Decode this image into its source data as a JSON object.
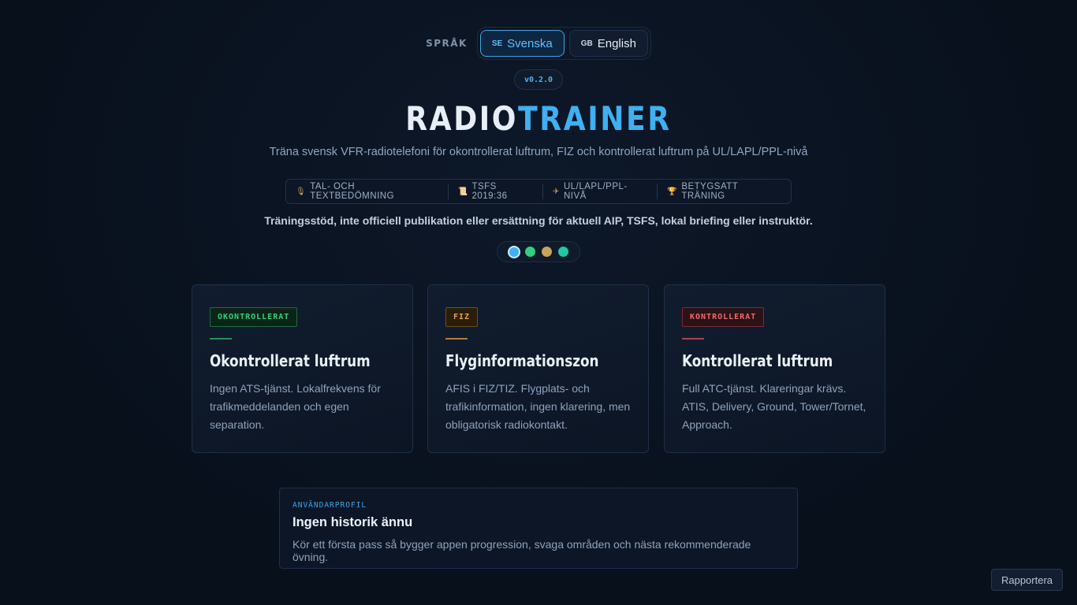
{
  "language": {
    "label": "SPRÅK",
    "options": [
      {
        "code": "SE",
        "label": "Svenska",
        "active": true
      },
      {
        "code": "GB",
        "label": "English",
        "active": false
      }
    ]
  },
  "version": "v0.2.0",
  "title": {
    "part1": "RADIO",
    "part2": "TRAINER"
  },
  "subtitle": "Träna svensk VFR-radiotelefoni för okontrollerat luftrum, FIZ och kontrollerat luftrum på UL/LAPL/PPL-nivå",
  "features": [
    {
      "icon": "microphone-icon",
      "glyph": "🎙",
      "label": "TAL- OCH TEXTBEDÖMNING"
    },
    {
      "icon": "scroll-icon",
      "glyph": "📜",
      "label": "TSFS 2019:36"
    },
    {
      "icon": "airplane-icon",
      "glyph": "✈",
      "label": "UL/LAPL/PPL-NIVÅ"
    },
    {
      "icon": "trophy-icon",
      "glyph": "🏆",
      "label": "BETYGSATT TRÄNING"
    }
  ],
  "disclaimer": "Träningsstöd, inte officiell publikation eller ersättning för aktuell AIP, TSFS, lokal briefing eller instruktör.",
  "theme_dots": [
    "#3fb0f2",
    "#2fd17e",
    "#c9a35a",
    "#22c7a4"
  ],
  "cards": [
    {
      "tag": "OKONTROLLERAT",
      "title": "Okontrollerat luftrum",
      "description": "Ingen ATS-tjänst. Lokalfrekvens för trafikmeddelanden och egen separation.",
      "color": "#35d07a"
    },
    {
      "tag": "FIZ",
      "title": "Flyginformationszon",
      "description": "AFIS i FIZ/TIZ. Flygplats- och trafikinformation, ingen klarering, men obligatorisk radiokontakt.",
      "color": "#e0a548"
    },
    {
      "tag": "KONTROLLERAT",
      "title": "Kontrollerat luftrum",
      "description": "Full ATC-tjänst. Klareringar krävs. ATIS, Delivery, Ground, Tower/Tornet, Approach.",
      "color": "#ef6a6a"
    }
  ],
  "profile": {
    "kicker": "ANVÄNDARPROFIL",
    "title": "Ingen historik ännu",
    "text": "Kör ett första pass så bygger appen progression, svaga områden och nästa rekommenderade övning."
  },
  "report_button": "Rapportera"
}
